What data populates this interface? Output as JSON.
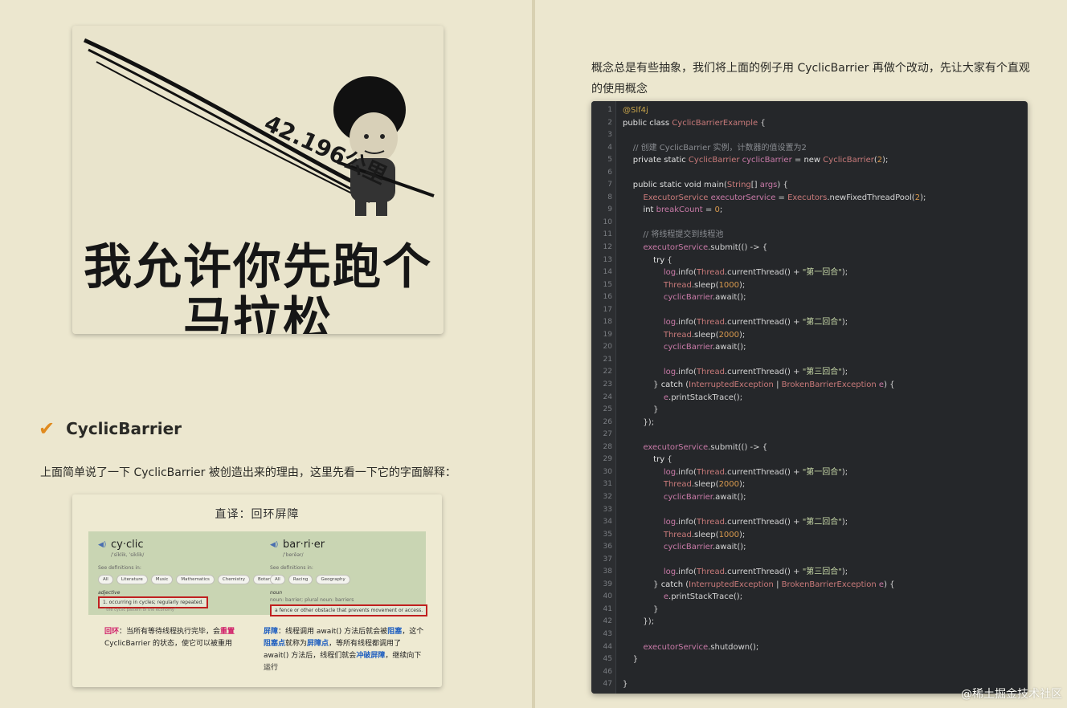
{
  "meme": {
    "distance_text": "42.196公里",
    "caption_line1": "我允许你先跑个",
    "caption_line2": "马拉松"
  },
  "section": {
    "title": "CyclicBarrier"
  },
  "left_paragraph": "上面简单说了一下 CyclicBarrier 被创造出来的理由，这里先看一下它的字面解释：",
  "dictionary": {
    "title": "直译：回环屏障",
    "left": {
      "word": "cy·clic",
      "phonetic": "/ˈsīklik, ˈsiklik/",
      "see_label": "See definitions in:",
      "chips": [
        "All",
        "Literature",
        "Music",
        "Mathematics",
        "Chemistry",
        "Botany"
      ],
      "pos": "adjective",
      "definition": "1. occurring in cycles; regularly repeated.",
      "example": "\"the cyclic pattern of the economy\""
    },
    "right": {
      "word": "bar·ri·er",
      "phonetic": "/ˈberēər/",
      "see_label": "See definitions in:",
      "chips": [
        "All",
        "Racing",
        "Geography"
      ],
      "pos": "noun",
      "noun_note": "noun: barrier; plural noun: barriers",
      "definition": "a fence or other obstacle that prevents movement or access."
    },
    "note_left": {
      "label": "回环",
      "text_a": "：当所有等待线程执行完毕，会",
      "emph": "重置",
      "text_b": "CyclicBarrier 的状态，使它可以被重用"
    },
    "note_right": {
      "label": "屏障",
      "text_a": "：线程调用 await() 方法后就会被",
      "emph1": "阻塞",
      "text_b": "，这个",
      "emph2": "阻塞点",
      "text_c": "就称为",
      "emph3": "屏障点",
      "text_d": "，等所有线程都调用了 await() 方法后，线程们就会",
      "emph4": "冲破屏障",
      "text_e": "，继续向下运行"
    }
  },
  "right_paragraph": "概念总是有些抽象，我们将上面的例子用 CyclicBarrier 再做个改动，先让大家有个直观的使用概念",
  "code_lines": [
    "@Slf4j",
    "public class CyclicBarrierExample {",
    "",
    "    // 创建 CyclicBarrier 实例，计数器的值设置为2",
    "    private static CyclicBarrier cyclicBarrier = new CyclicBarrier(2);",
    "",
    "    public static void main(String[] args) {",
    "        ExecutorService executorService = Executors.newFixedThreadPool(2);",
    "        int breakCount = 0;",
    "",
    "        // 将线程提交到线程池",
    "        executorService.submit(() -> {",
    "            try {",
    "                log.info(Thread.currentThread() + \"第一回合\");",
    "                Thread.sleep(1000);",
    "                cyclicBarrier.await();",
    "",
    "                log.info(Thread.currentThread() + \"第二回合\");",
    "                Thread.sleep(2000);",
    "                cyclicBarrier.await();",
    "",
    "                log.info(Thread.currentThread() + \"第三回合\");",
    "            } catch (InterruptedException | BrokenBarrierException e) {",
    "                e.printStackTrace();",
    "            }",
    "        });",
    "",
    "        executorService.submit(() -> {",
    "            try {",
    "                log.info(Thread.currentThread() + \"第一回合\");",
    "                Thread.sleep(2000);",
    "                cyclicBarrier.await();",
    "",
    "                log.info(Thread.currentThread() + \"第二回合\");",
    "                Thread.sleep(1000);",
    "                cyclicBarrier.await();",
    "",
    "                log.info(Thread.currentThread() + \"第三回合\");",
    "            } catch (InterruptedException | BrokenBarrierException e) {",
    "                e.printStackTrace();",
    "            }",
    "        });",
    "",
    "        executorService.shutdown();",
    "    }",
    "",
    "}"
  ],
  "watermark": "@稀土掘金技术社区",
  "colors": {
    "check": "#e08a1e",
    "highlight_red": "#d0206a",
    "highlight_blue": "#1f5fc0",
    "code_bg": "#25272a"
  }
}
